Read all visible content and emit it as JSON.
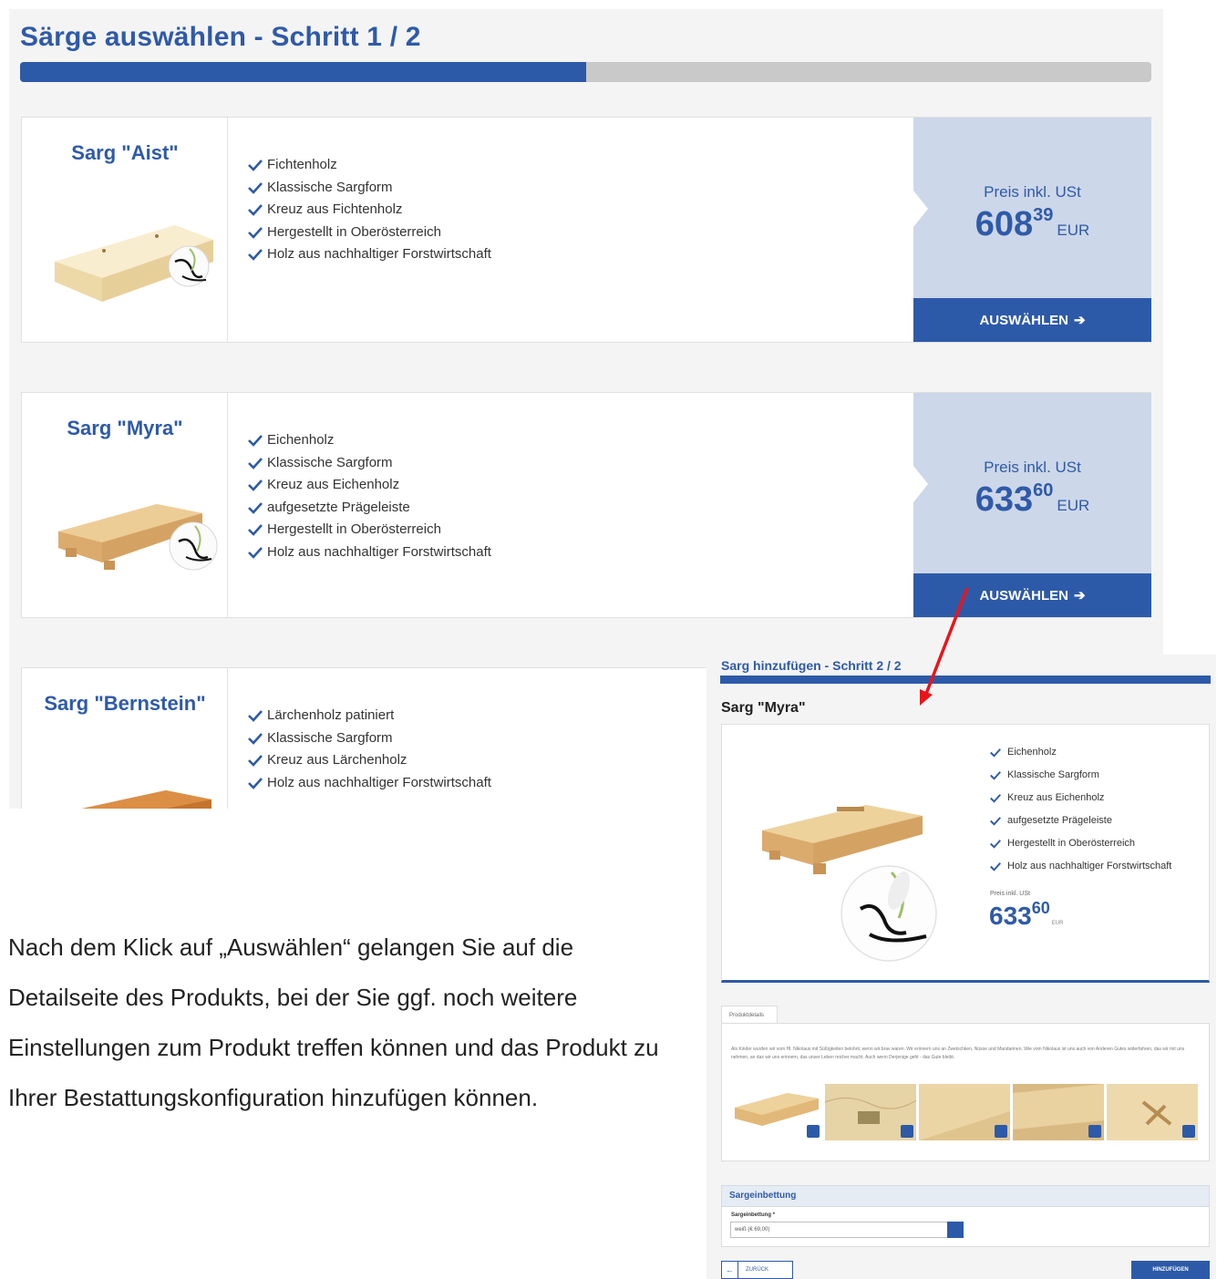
{
  "step1": {
    "title": "Särge auswählen - Schritt 1 / 2",
    "progress": 0.5,
    "cards": [
      {
        "name": "Sarg \"Aist\"",
        "features": [
          "Fichtenholz",
          "Klassische Sargform",
          "Kreuz aus Fichtenholz",
          "Hergestellt in Oberösterreich",
          "Holz aus nachhaltiger Forstwirtschaft"
        ],
        "price_label": "Preis inkl. USt",
        "price_int": "608",
        "price_dec": "39",
        "currency": "EUR",
        "button": "AUSWÄHLEN"
      },
      {
        "name": "Sarg \"Myra\"",
        "features": [
          "Eichenholz",
          "Klassische Sargform",
          "Kreuz aus Eichenholz",
          "aufgesetzte Prägeleiste",
          "Hergestellt in Oberösterreich",
          "Holz aus nachhaltiger Forstwirtschaft"
        ],
        "price_label": "Preis inkl. USt",
        "price_int": "633",
        "price_dec": "60",
        "currency": "EUR",
        "button": "AUSWÄHLEN"
      },
      {
        "name": "Sarg \"Bernstein\"",
        "features": [
          "Lärchenholz patiniert",
          "Klassische Sargform",
          "Kreuz aus Lärchenholz",
          "Holz aus nachhaltiger Forstwirtschaft"
        ]
      }
    ]
  },
  "explanation": "Nach dem Klick auf „Auswählen“ gelangen Sie auf die Detailseite des Produkts, bei der Sie ggf. noch weitere Einstellungen zum Produkt treffen können und das Produkt zu Ihrer Bestattungskonfiguration hinzufügen können.",
  "step2": {
    "title": "Sarg hinzufügen - Schritt 2 / 2",
    "progress": 1.0,
    "product_name": "Sarg \"Myra\"",
    "features": [
      "Eichenholz",
      "Klassische Sargform",
      "Kreuz aus Eichenholz",
      "aufgesetzte Prägeleiste",
      "Hergestellt in Oberösterreich",
      "Holz aus nachhaltiger Forstwirtschaft"
    ],
    "price_label": "Preis inkl. USt",
    "price_int": "633",
    "price_dec": "60",
    "currency": "EUR",
    "tab_label": "Produktdetails",
    "description": "Als Kinder wurden wir vom Hl. Nikolaus mit Süßigkeiten belohnt, wenn wir brav waren. Wir erinnern uns an Zwetschken, Nüsse und Mandarinen. Wie vom Nikolaus ist uns auch von Anderen Gutes widerfahren, das wir mit uns nehmen, an das wir uns erinnern, das unser Leben reicher macht. Auch wenn Derjenige geht - das Gute bleibt.",
    "section_title": "Sargeinbettung",
    "field_label": "Sargeinbettung *",
    "field_value": "weiß (€ 69,00)",
    "back_button": "ZURÜCK",
    "add_button": "HINZUFÜGEN"
  },
  "colors": {
    "brand_blue": "#2d5aa8",
    "price_bg": "#ccd7e9",
    "arrow_red": "#e8151b"
  }
}
